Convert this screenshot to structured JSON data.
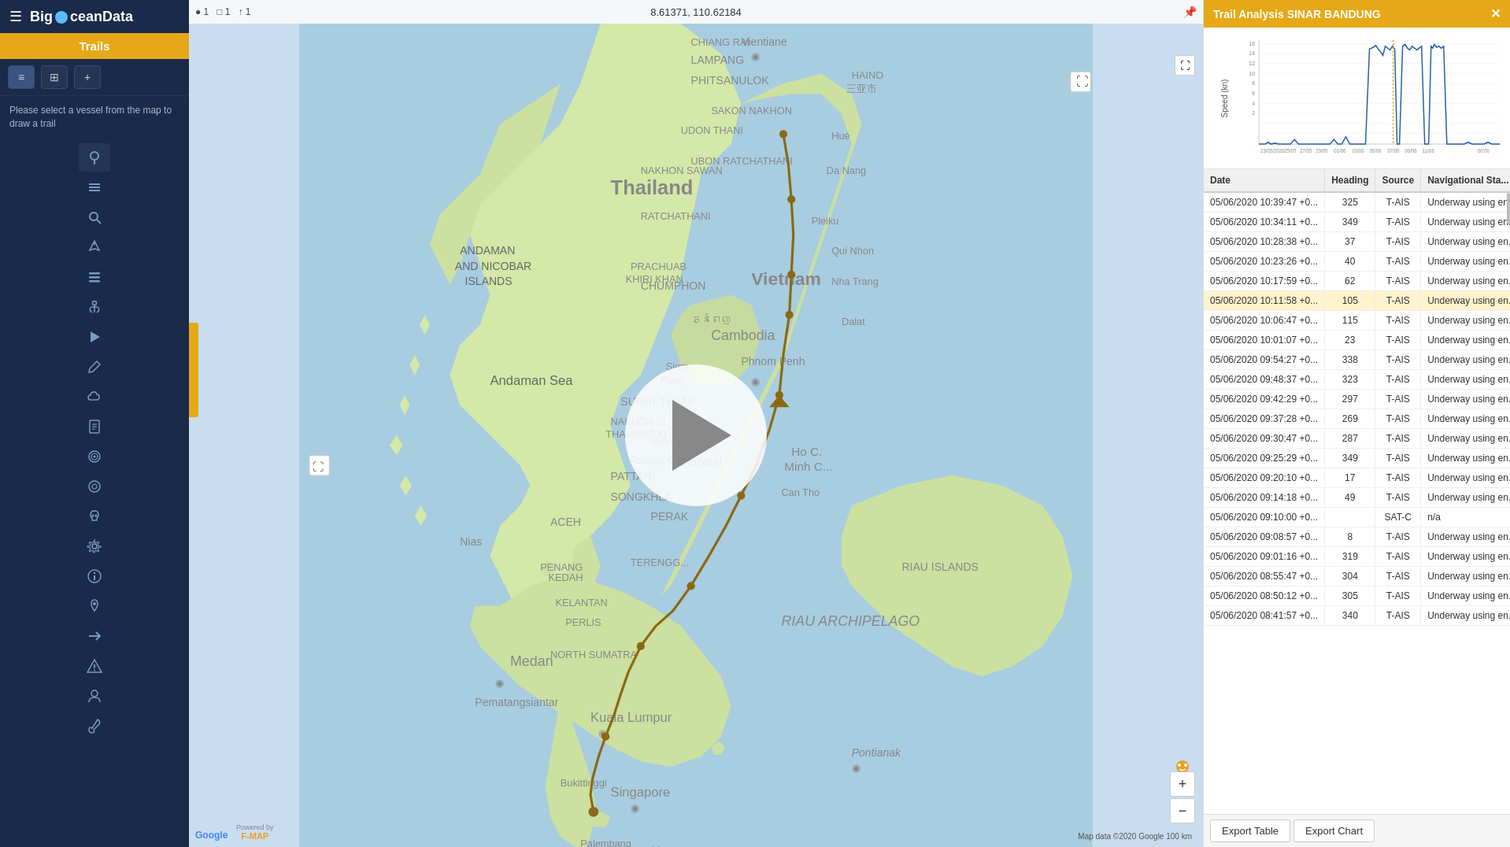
{
  "sidebar": {
    "logo_text": "BigOceanData",
    "logo_o": "O",
    "trails_label": "Trails",
    "trails_hint": "Please select a vessel from the map to draw a trail",
    "nav_icons": [
      {
        "name": "map-icon",
        "symbol": "⊕",
        "label": "Map"
      },
      {
        "name": "layers-icon",
        "symbol": "≡",
        "label": "Layers"
      },
      {
        "name": "search-icon",
        "symbol": "🔍",
        "label": "Search"
      },
      {
        "name": "vessel-icon",
        "symbol": "🚢",
        "label": "Vessel"
      },
      {
        "name": "list-icon",
        "symbol": "📋",
        "label": "List"
      },
      {
        "name": "anchor-icon",
        "symbol": "⚓",
        "label": "Anchor"
      },
      {
        "name": "play-icon",
        "symbol": "▶",
        "label": "Play"
      },
      {
        "name": "edit-icon",
        "symbol": "✏",
        "label": "Edit"
      },
      {
        "name": "cloud-icon",
        "symbol": "☁",
        "label": "Cloud"
      },
      {
        "name": "document-icon",
        "symbol": "📄",
        "label": "Document"
      },
      {
        "name": "target-icon",
        "symbol": "🎯",
        "label": "Target"
      },
      {
        "name": "circle-icon",
        "symbol": "◎",
        "label": "Circle"
      },
      {
        "name": "skull-icon",
        "symbol": "💀",
        "label": "Skull"
      },
      {
        "name": "settings-icon",
        "symbol": "⚙",
        "label": "Settings"
      },
      {
        "name": "info-icon",
        "symbol": "ℹ",
        "label": "Info"
      },
      {
        "name": "pin-icon",
        "symbol": "📌",
        "label": "Pin"
      },
      {
        "name": "arrow-icon",
        "symbol": "→",
        "label": "Arrow"
      },
      {
        "name": "warning-icon",
        "symbol": "⚠",
        "label": "Warning"
      },
      {
        "name": "user-icon",
        "symbol": "👤",
        "label": "User"
      },
      {
        "name": "wrench-icon",
        "symbol": "🔧",
        "label": "Wrench"
      }
    ]
  },
  "map": {
    "coordinates": "8.61371, 110.62184",
    "indicators": "● 1  □ 1  ↑ 1",
    "google_label": "Google",
    "powered_by": "Powered by",
    "fmap_label": "F-MAP",
    "map_data_text": "Map data ©2020 Google  100 km"
  },
  "trail_tools": [
    {
      "icon": "≡",
      "label": "list"
    },
    {
      "icon": "⊞",
      "label": "grid"
    },
    {
      "icon": "+",
      "label": "add"
    }
  ],
  "panel": {
    "title": "Trail Analysis SINAR BANDUNG",
    "close_icon": "✕",
    "chart": {
      "y_label": "Speed (kn)",
      "y_max": 16,
      "x_labels": [
        "23/05/2020",
        "25/05",
        "27/05",
        "29/05",
        "01/06",
        "03/06",
        "05/06",
        "07/06",
        "09/06",
        "11/06",
        "00:00"
      ],
      "data_points": [
        0,
        0,
        1,
        0,
        0.5,
        0,
        0,
        0,
        1.5,
        3,
        0,
        0,
        0,
        2,
        4,
        0,
        0,
        15,
        14,
        13,
        12,
        15,
        14,
        13,
        0,
        0,
        14,
        15,
        14,
        15,
        14,
        0,
        0,
        14,
        15,
        14,
        0,
        0,
        0,
        0,
        0,
        0,
        0,
        0,
        0,
        2,
        0,
        0,
        0,
        1,
        0
      ]
    },
    "table": {
      "columns": [
        "Date",
        "Heading",
        "Source",
        "Navigational Sta..."
      ],
      "rows": [
        {
          "date": "05/06/2020 10:39:47 +0...",
          "heading": "325",
          "source": "T-AIS",
          "nav_status": "Underway using en...",
          "highlighted": false
        },
        {
          "date": "05/06/2020 10:34:11 +0...",
          "heading": "349",
          "source": "T-AIS",
          "nav_status": "Underway using en...",
          "highlighted": false
        },
        {
          "date": "05/06/2020 10:28:38 +0...",
          "heading": "37",
          "source": "T-AIS",
          "nav_status": "Underway using en...",
          "highlighted": false
        },
        {
          "date": "05/06/2020 10:23:26 +0...",
          "heading": "40",
          "source": "T-AIS",
          "nav_status": "Underway using en...",
          "highlighted": false
        },
        {
          "date": "05/06/2020 10:17:59 +0...",
          "heading": "62",
          "source": "T-AIS",
          "nav_status": "Underway using en...",
          "highlighted": false
        },
        {
          "date": "05/06/2020 10:11:58 +0...",
          "heading": "105",
          "source": "T-AIS",
          "nav_status": "Underway using en...",
          "highlighted": true
        },
        {
          "date": "05/06/2020 10:06:47 +0...",
          "heading": "115",
          "source": "T-AIS",
          "nav_status": "Underway using en...",
          "highlighted": false
        },
        {
          "date": "05/06/2020 10:01:07 +0...",
          "heading": "23",
          "source": "T-AIS",
          "nav_status": "Underway using en...",
          "highlighted": false
        },
        {
          "date": "05/06/2020 09:54:27 +0...",
          "heading": "338",
          "source": "T-AIS",
          "nav_status": "Underway using en...",
          "highlighted": false
        },
        {
          "date": "05/06/2020 09:48:37 +0...",
          "heading": "323",
          "source": "T-AIS",
          "nav_status": "Underway using en...",
          "highlighted": false
        },
        {
          "date": "05/06/2020 09:42:29 +0...",
          "heading": "297",
          "source": "T-AIS",
          "nav_status": "Underway using en...",
          "highlighted": false
        },
        {
          "date": "05/06/2020 09:37:28 +0...",
          "heading": "269",
          "source": "T-AIS",
          "nav_status": "Underway using en...",
          "highlighted": false
        },
        {
          "date": "05/06/2020 09:30:47 +0...",
          "heading": "287",
          "source": "T-AIS",
          "nav_status": "Underway using en...",
          "highlighted": false
        },
        {
          "date": "05/06/2020 09:25:29 +0...",
          "heading": "349",
          "source": "T-AIS",
          "nav_status": "Underway using en...",
          "highlighted": false
        },
        {
          "date": "05/06/2020 09:20:10 +0...",
          "heading": "17",
          "source": "T-AIS",
          "nav_status": "Underway using en...",
          "highlighted": false
        },
        {
          "date": "05/06/2020 09:14:18 +0...",
          "heading": "49",
          "source": "T-AIS",
          "nav_status": "Underway using en...",
          "highlighted": false
        },
        {
          "date": "05/06/2020 09:10:00 +0...",
          "heading": "",
          "source": "SAT-C",
          "nav_status": "n/a",
          "highlighted": false
        },
        {
          "date": "05/06/2020 09:08:57 +0...",
          "heading": "8",
          "source": "T-AIS",
          "nav_status": "Underway using en...",
          "highlighted": false
        },
        {
          "date": "05/06/2020 09:01:16 +0...",
          "heading": "319",
          "source": "T-AIS",
          "nav_status": "Underway using en...",
          "highlighted": false
        },
        {
          "date": "05/06/2020 08:55:47 +0...",
          "heading": "304",
          "source": "T-AIS",
          "nav_status": "Underway using en...",
          "highlighted": false
        },
        {
          "date": "05/06/2020 08:50:12 +0...",
          "heading": "305",
          "source": "T-AIS",
          "nav_status": "Underway using en...",
          "highlighted": false
        },
        {
          "date": "05/06/2020 08:41:57 +0...",
          "heading": "340",
          "source": "T-AIS",
          "nav_status": "Underway using en...",
          "highlighted": false
        }
      ]
    },
    "buttons": [
      {
        "label": "Export Table",
        "name": "export-table-button"
      },
      {
        "label": "Export Chart",
        "name": "export-chart-button"
      }
    ]
  }
}
